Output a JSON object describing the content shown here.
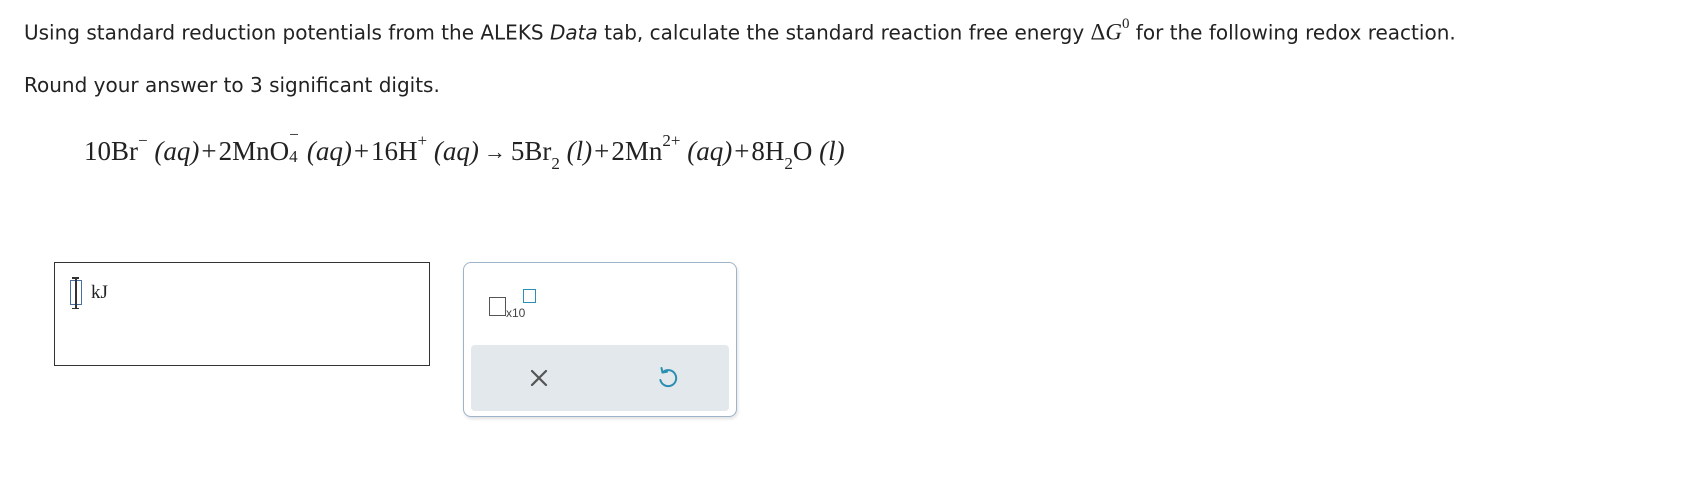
{
  "prompt": {
    "line1_before_data": "Using standard reduction potentials from the ALEKS ",
    "data_word": "Data",
    "line1_after_data": " tab, calculate the standard reaction free energy ",
    "delta_symbol": "Δ",
    "g_symbol": "G",
    "superscript_zero": "0",
    "line1_end": " for the following redox reaction.",
    "line2": "Round your answer to 3 significant digits."
  },
  "equation": {
    "coef_br": "10",
    "br_species": "Br",
    "br_charge": "−",
    "state_aq": "(aq)",
    "plus": "+",
    "coef_mno4": "2",
    "mno4_species": "MnO",
    "mno4_charge": "−",
    "mno4_sub": "4",
    "coef_h": "16",
    "h_species": "H",
    "h_charge": "+",
    "arrow": "→",
    "coef_br2": "5",
    "br2_species": "Br",
    "br2_sub": "2",
    "state_l": "(l)",
    "coef_mn": "2",
    "mn_species": "Mn",
    "mn_charge": "2+",
    "coef_h2o": "8",
    "h2o_h": "H",
    "h2o_sub": "2",
    "h2o_o": "O"
  },
  "answer": {
    "value": "",
    "unit": "kJ"
  },
  "tools": {
    "x10_label": "x10",
    "icons": {
      "scientific_notation": "scientific-notation-icon",
      "clear": "close-icon",
      "reset": "undo-icon"
    }
  },
  "colors": {
    "text": "#222222",
    "panel_border": "#9eb4c8",
    "action_bar": "#e2e8ec",
    "accent": "#2a8fb0",
    "cursor_outline": "#4a6fa5"
  }
}
